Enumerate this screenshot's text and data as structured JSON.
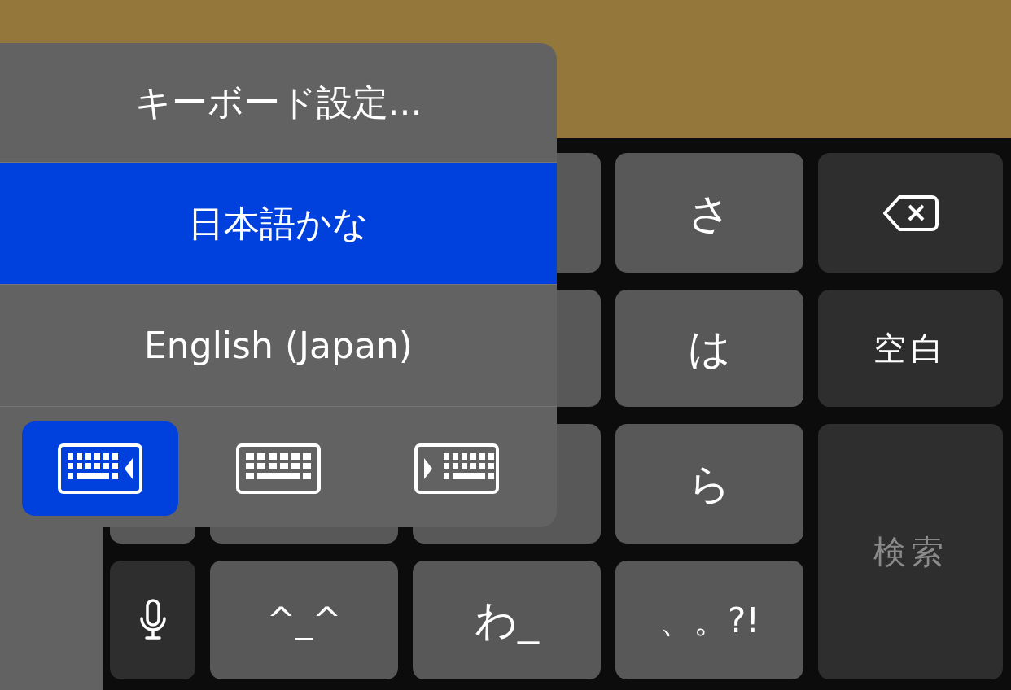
{
  "menu": {
    "items": [
      {
        "label": "キーボード設定...",
        "selected": false
      },
      {
        "label": "日本語かな",
        "selected": true
      },
      {
        "label": "English (Japan)",
        "selected": false
      }
    ],
    "placements": [
      {
        "kind": "left",
        "selected": true
      },
      {
        "kind": "full",
        "selected": false
      },
      {
        "kind": "right",
        "selected": false
      }
    ]
  },
  "key_rows": [
    [
      {
        "kind": "covered"
      },
      {
        "kind": "letter",
        "text": "さ"
      },
      {
        "kind": "backspace"
      }
    ],
    [
      {
        "kind": "covered"
      },
      {
        "kind": "letter",
        "text": "は"
      },
      {
        "kind": "function",
        "text": "空白"
      }
    ],
    [
      {
        "kind": "covered"
      },
      {
        "kind": "covered"
      },
      {
        "kind": "covered"
      },
      {
        "kind": "letter",
        "text": "ら"
      },
      {
        "kind": "return",
        "text": "検索",
        "disabled": true
      }
    ],
    [
      {
        "kind": "mic"
      },
      {
        "kind": "letter",
        "text": "^_^"
      },
      {
        "kind": "letter",
        "text": "わ_"
      },
      {
        "kind": "letter",
        "text": "、。?!"
      }
    ]
  ]
}
